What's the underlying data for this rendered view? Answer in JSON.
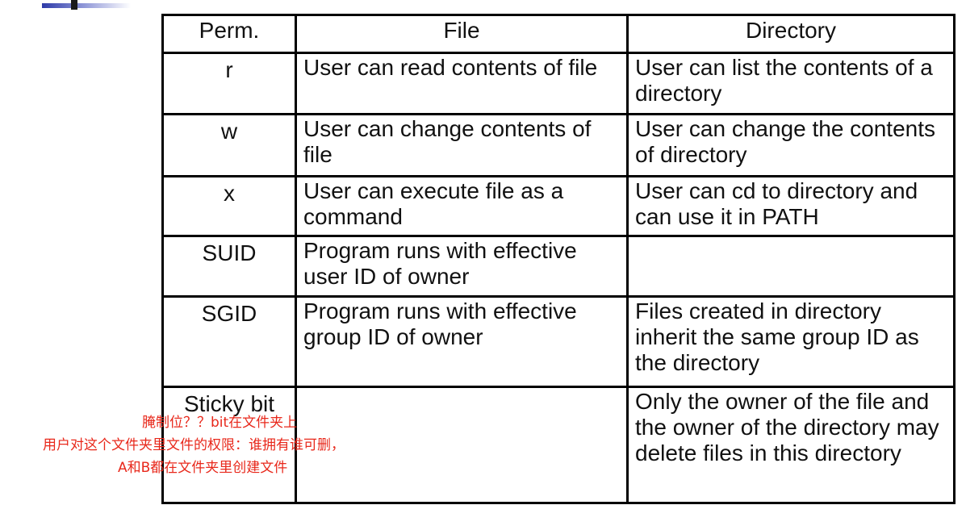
{
  "table": {
    "headers": [
      "Perm.",
      "File",
      "Directory"
    ],
    "rows": [
      {
        "perm": "r",
        "file": "User can read contents of file",
        "directory": "User can list the contents of a directory"
      },
      {
        "perm": "w",
        "file": "User can change contents of file",
        "directory": "User can change the contents of directory"
      },
      {
        "perm": "x",
        "file": "User can execute file as a command",
        "directory": "User can cd to directory and can use it in PATH"
      },
      {
        "perm": "SUID",
        "file": "Program runs with effective user ID of owner",
        "directory": ""
      },
      {
        "perm": "SGID",
        "file": "Program runs with effective group ID of owner",
        "directory": "Files created in directory inherit the same group ID as the directory"
      },
      {
        "perm": "Sticky bit",
        "file": "",
        "directory": "Only the owner of the file and the owner of the directory may delete files in this directory"
      }
    ]
  },
  "annotations": [
    "腌制位？？bit在文件夹上",
    "用户对这个文件夹里文件的权限：谁拥有谁可删，",
    "A和B都在文件夹里创建文件"
  ],
  "colors": {
    "annotation": "#e8281b",
    "border": "#000000",
    "corner_bar": "#2d3aa8"
  }
}
